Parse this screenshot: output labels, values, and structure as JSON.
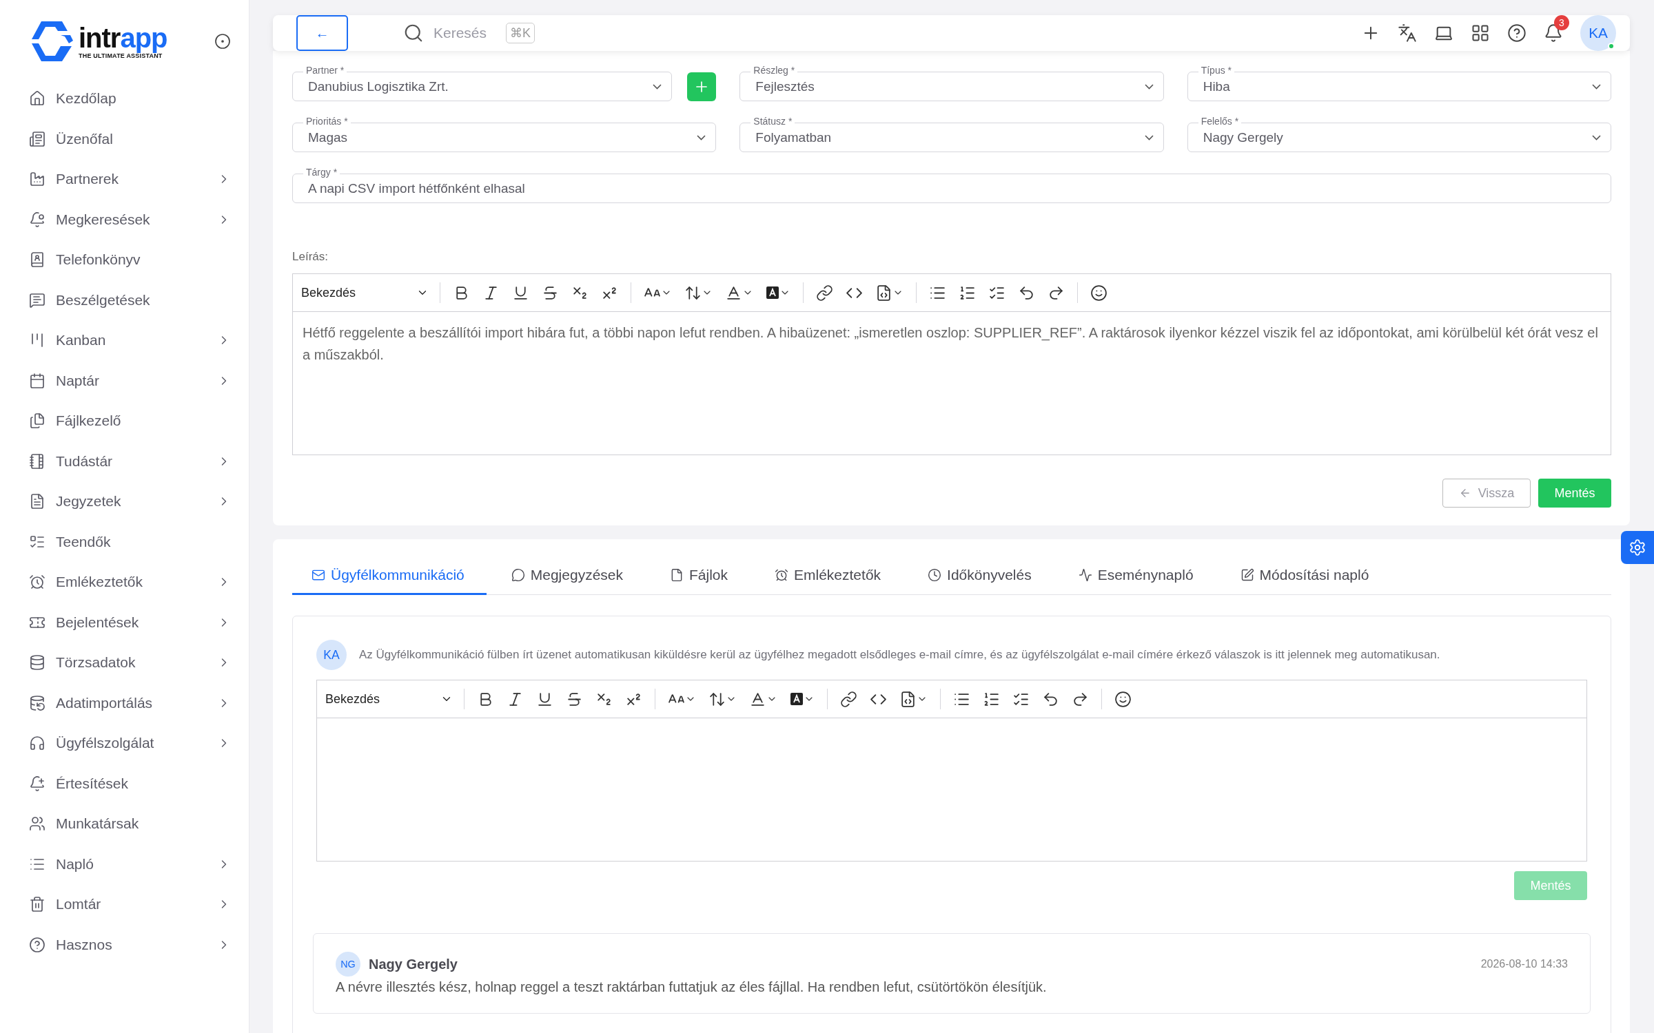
{
  "sidebar": {
    "logo": {
      "word_dark": "intr",
      "word_blue": "app",
      "tagline": "THE ULTIMATE ASSISTANT"
    },
    "items": [
      {
        "label": "Kezdőlap",
        "expandable": false
      },
      {
        "label": "Üzenőfal",
        "expandable": false
      },
      {
        "label": "Partnerek",
        "expandable": true
      },
      {
        "label": "Megkeresések",
        "expandable": true
      },
      {
        "label": "Telefonkönyv",
        "expandable": false
      },
      {
        "label": "Beszélgetések",
        "expandable": false
      },
      {
        "label": "Kanban",
        "expandable": true
      },
      {
        "label": "Naptár",
        "expandable": true
      },
      {
        "label": "Fájlkezelő",
        "expandable": false
      },
      {
        "label": "Tudástár",
        "expandable": true
      },
      {
        "label": "Jegyzetek",
        "expandable": true
      },
      {
        "label": "Teendők",
        "expandable": false
      },
      {
        "label": "Emlékeztetők",
        "expandable": true
      },
      {
        "label": "Bejelentések",
        "expandable": true
      },
      {
        "label": "Törzsadatok",
        "expandable": true
      },
      {
        "label": "Adatimportálás",
        "expandable": true
      },
      {
        "label": "Ügyfélszolgálat",
        "expandable": true
      },
      {
        "label": "Értesítések",
        "expandable": false
      },
      {
        "label": "Munkatársak",
        "expandable": false
      },
      {
        "label": "Napló",
        "expandable": true
      },
      {
        "label": "Lomtár",
        "expandable": true
      },
      {
        "label": "Hasznos",
        "expandable": true
      }
    ]
  },
  "header": {
    "back": "←",
    "search": {
      "placeholder": "Keresés",
      "shortcut": "⌘K"
    },
    "notifications": "3",
    "avatar": {
      "initials": "KA",
      "online": true
    }
  },
  "form": {
    "fields": [
      {
        "kind": "select",
        "label": "Partner *",
        "value": "Danubius Logisztika Zrt.",
        "add_button": true
      },
      {
        "kind": "select",
        "label": "Részleg *",
        "value": "Fejlesztés",
        "add_button": false
      },
      {
        "kind": "select",
        "label": "Típus *",
        "value": "Hiba",
        "add_button": false
      },
      {
        "kind": "select",
        "label": "Prioritás *",
        "value": "Magas",
        "add_button": false
      },
      {
        "kind": "select",
        "label": "Státusz *",
        "value": "Folyamatban",
        "add_button": false
      },
      {
        "kind": "select",
        "label": "Felelős *",
        "value": "Nagy Gergely",
        "add_button": false
      },
      {
        "kind": "text",
        "label": "Tárgy *",
        "value": "A napi CSV import hétfőnként elhasal",
        "add_button": false
      }
    ],
    "description": {
      "label": "Leírás:",
      "format": "Bekezdés",
      "text": "Hétfő reggelente a beszállítói import hibára fut, a többi napon lefut rendben. A hibaüzenet: „ismeretlen oszlop: SUPPLIER_REF”. A raktárosok ilyenkor kézzel viszik fel az időpontokat, ami körülbelül két órát vesz el a műszakból."
    },
    "back_button": "Vissza",
    "save_button": "Mentés"
  },
  "tabs": [
    {
      "label": "Ügyfélkommunikáció",
      "selected": true
    },
    {
      "label": "Megjegyzések",
      "selected": false
    },
    {
      "label": "Fájlok",
      "selected": false
    },
    {
      "label": "Emlékeztetők",
      "selected": false
    },
    {
      "label": "Időkönyvelés",
      "selected": false
    },
    {
      "label": "Eseménynapló",
      "selected": false
    },
    {
      "label": "Módosítási napló",
      "selected": false
    }
  ],
  "communication": {
    "avatar": "KA",
    "notice": "Az Ügyfélkommunikáció fülben írt üzenet automatikusan kiküldésre kerül az ügyfélhez megadott elsődleges e-mail címre, és az ügyfélszolgálat e-mail címére érkező válaszok is itt jelennek meg automatikusan.",
    "format": "Bekezdés",
    "save": {
      "label": "Mentés",
      "disabled": true
    }
  },
  "messages": [
    {
      "initials": "NG",
      "author": "Nagy Gergely",
      "time": "2026-08-10 14:33",
      "text": "A névre illesztés kész, holnap reggel a teszt raktárban futtatjuk az éles fájllal. Ha rendben lefut, csütörtökön élesítjük."
    }
  ]
}
